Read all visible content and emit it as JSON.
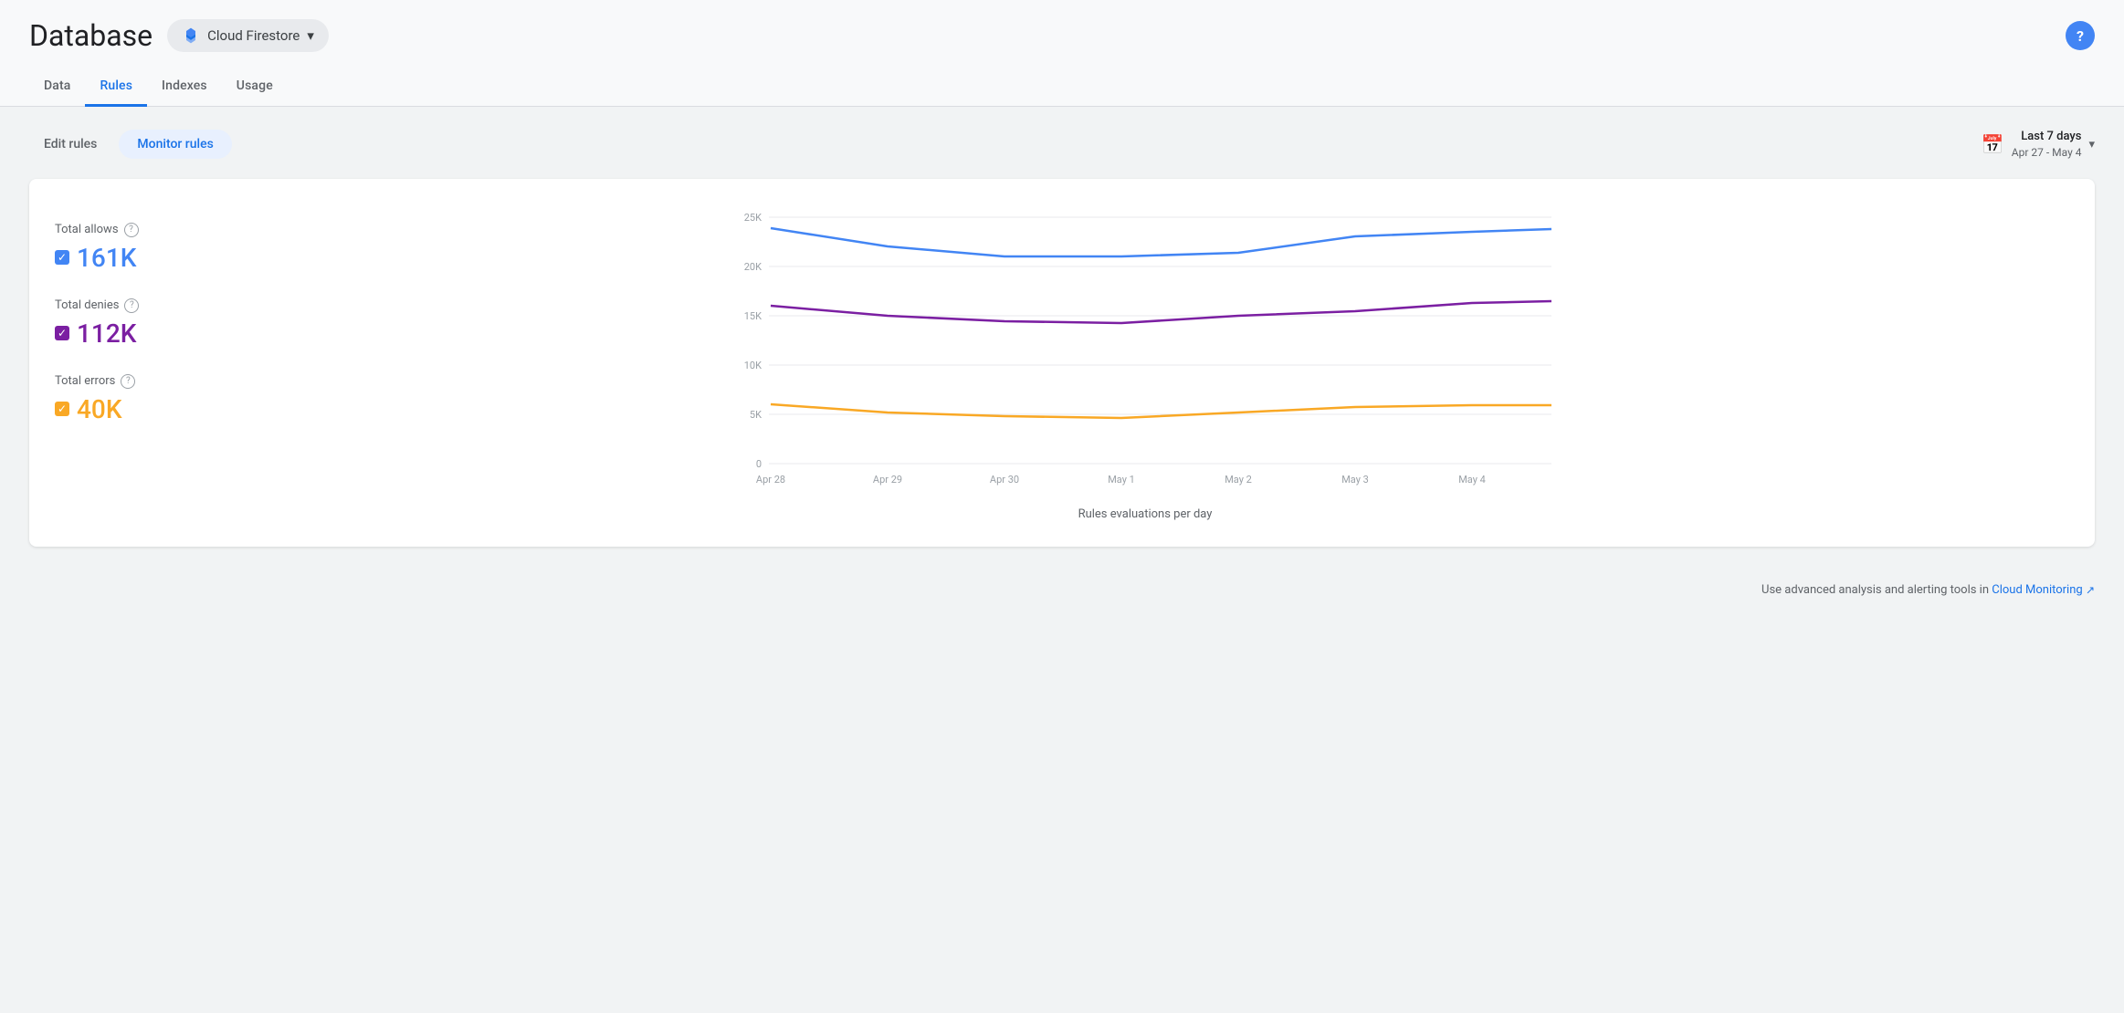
{
  "header": {
    "title": "Database",
    "service": {
      "name": "Cloud Firestore",
      "icon": "firestore"
    }
  },
  "tabs": [
    {
      "id": "data",
      "label": "Data",
      "active": false
    },
    {
      "id": "rules",
      "label": "Rules",
      "active": true
    },
    {
      "id": "indexes",
      "label": "Indexes",
      "active": false
    },
    {
      "id": "usage",
      "label": "Usage",
      "active": false
    }
  ],
  "toolbar": {
    "edit_rules_label": "Edit rules",
    "monitor_rules_label": "Monitor rules",
    "date_range_main": "Last 7 days",
    "date_range_sub": "Apr 27 - May 4"
  },
  "chart": {
    "title": "Rules evaluations per day",
    "legend": [
      {
        "id": "allows",
        "label": "Total allows",
        "value": "161K",
        "color_class": "blue",
        "color_hex": "#4285f4"
      },
      {
        "id": "denies",
        "label": "Total denies",
        "value": "112K",
        "color_class": "purple",
        "color_hex": "#7b1fa2"
      },
      {
        "id": "errors",
        "label": "Total errors",
        "value": "40K",
        "color_class": "yellow",
        "color_hex": "#f9a825"
      }
    ],
    "y_axis": [
      "25K",
      "20K",
      "15K",
      "10K",
      "5K",
      "0"
    ],
    "x_axis": [
      "Apr 28",
      "Apr 29",
      "Apr 30",
      "May 1",
      "May 2",
      "May 3",
      "May 4"
    ]
  },
  "footer": {
    "text": "Use advanced analysis and alerting tools in",
    "link_label": "Cloud Monitoring",
    "link_icon": "external-link"
  }
}
